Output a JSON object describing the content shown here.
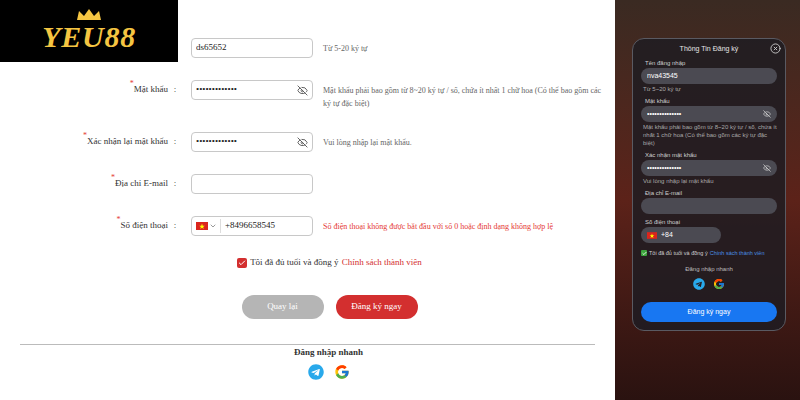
{
  "logo": {
    "text": "YEU88"
  },
  "desktop_form": {
    "required_mark": "*",
    "separator": ":",
    "fields": [
      {
        "kind": "text",
        "label": "",
        "required": false,
        "value": "ds65652",
        "hint": "Từ 5-20 ký tự",
        "error": false
      },
      {
        "kind": "password",
        "label": "Mật khẩu",
        "required": true,
        "value": "•••••••••••••",
        "hint": "Mật khẩu phải bao gồm từ 8~20 ký tự / số, chứa ít nhất 1 chữ hoa (Có thể bao gồm các ký tự đặc biệt)",
        "error": false
      },
      {
        "kind": "password",
        "label": "Xác nhận lại mật khẩu",
        "required": true,
        "value": "•••••••••••••",
        "hint": "Vui lòng nhập lại mật khẩu.",
        "error": false
      },
      {
        "kind": "text",
        "label": "Địa chỉ E-mail",
        "required": true,
        "value": "",
        "hint": "",
        "error": false
      },
      {
        "kind": "phone",
        "label": "Số điện thoại",
        "required": true,
        "value": "+8496658545",
        "hint": "Số điện thoại không được bắt đầu với số 0 hoặc định dạng không hợp lệ",
        "error": true
      }
    ],
    "agree": {
      "checked": true,
      "text": "Tôi đã đủ tuổi và đồng ý",
      "link": "Chính sách thành viên"
    },
    "buttons": [
      {
        "label": "Quay lại",
        "primary": false
      },
      {
        "label": "Đăng ký ngay",
        "primary": true
      }
    ],
    "quick_login": {
      "title": "Đăng nhập nhanh"
    }
  },
  "mobile_form": {
    "title": "Thông Tin Đăng ký",
    "fields": [
      {
        "kind": "text",
        "label": "Tên đăng nhập",
        "value": "nva43545",
        "hint": "Từ 5~20 ký tự"
      },
      {
        "kind": "password",
        "label": "Mật khẩu",
        "value": "••••••••••••••",
        "hint": "Mật khẩu phải bao gồm từ 8~20 ký tự / số, chứa ít nhất 1 chữ hoa (Có thể bao gồm các ký tự đặc biệt)"
      },
      {
        "kind": "password",
        "label": "Xác nhận mật khẩu",
        "value": "••••••••••••••",
        "hint": "Vui lòng nhập lại mật khẩu"
      },
      {
        "kind": "text",
        "label": "Địa chỉ E-mail",
        "value": "",
        "hint": ""
      },
      {
        "kind": "phone",
        "label": "Số điện thoại",
        "value": "+84",
        "hint": ""
      }
    ],
    "agree": {
      "checked": true,
      "text": "Tôi đã đủ tuổi và đồng ý",
      "link": "Chính sách thành viên"
    },
    "quick_login": {
      "title": "Đăng nhập nhanh"
    },
    "submit": "Đăng ký ngay"
  }
}
